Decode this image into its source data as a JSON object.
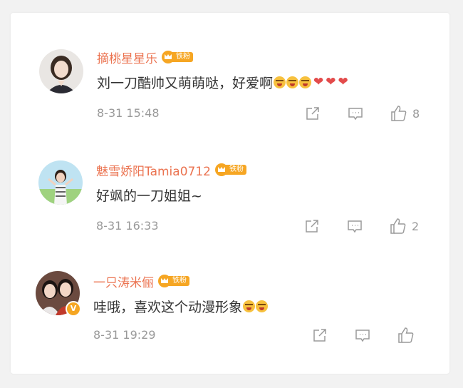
{
  "comments": [
    {
      "username": "摘桃星星乐",
      "fan_badge": "铁粉",
      "text": "刘一刀酷帅又萌萌哒，好爱啊",
      "emoji_count": 3,
      "heart_count": 3,
      "time": "8-31 15:48",
      "likes": "8"
    },
    {
      "username": "魅雪娇阳Tamia0712",
      "fan_badge": "铁粉",
      "text": "好飒的一刀姐姐~",
      "time": "8-31 16:33",
      "likes": "2"
    },
    {
      "username": "一只涛米俪",
      "fan_badge": "铁粉",
      "text": "哇哦，喜欢这个动漫形象",
      "emoji_count": 2,
      "verified_badge": "V",
      "time": "8-31 19:29",
      "likes": ""
    }
  ],
  "icons": {
    "share": "share-icon",
    "comment": "comment-icon",
    "like": "thumbs-up-icon"
  },
  "colors": {
    "username": "#eb7350",
    "badge": "#f6a623",
    "meta": "#999999",
    "text": "#333333"
  }
}
